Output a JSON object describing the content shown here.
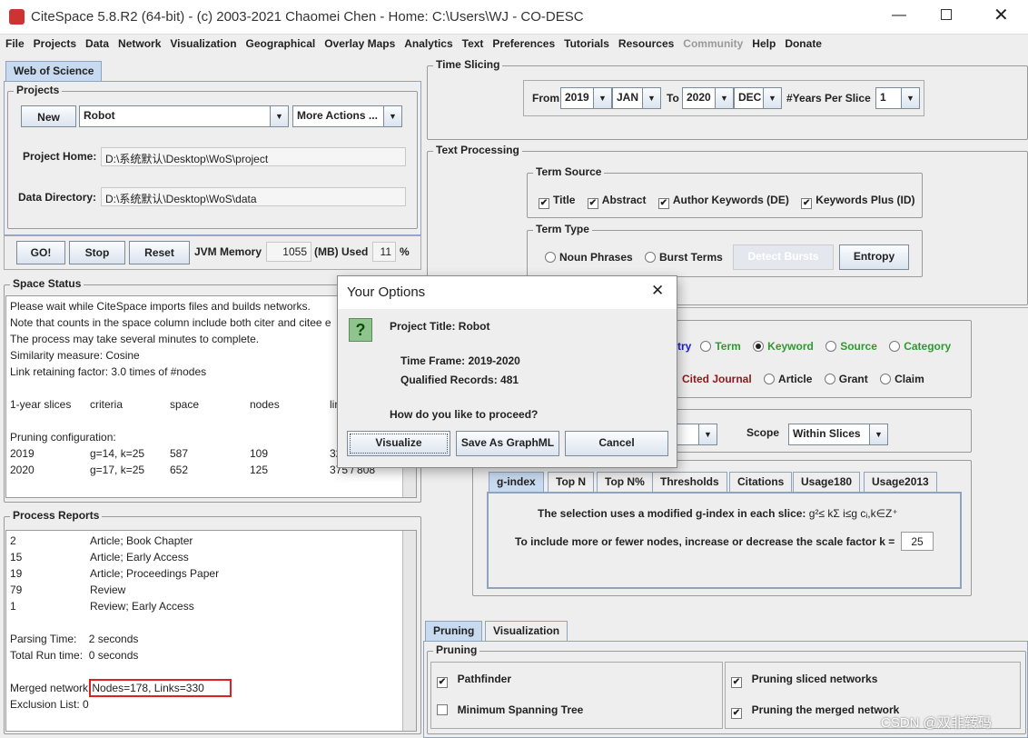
{
  "window": {
    "title": "CiteSpace 5.8.R2 (64-bit) - (c) 2003-2021 Chaomei Chen - Home: C:\\Users\\WJ - CO-DESC"
  },
  "menu": [
    "File",
    "Projects",
    "Data",
    "Network",
    "Visualization",
    "Geographical",
    "Overlay Maps",
    "Analytics",
    "Text",
    "Preferences",
    "Tutorials",
    "Resources",
    "Community",
    "Help",
    "Donate"
  ],
  "left": {
    "tab": "Web of Science",
    "projects": {
      "legend": "Projects",
      "new": "New",
      "project": "Robot",
      "more": "More Actions ...",
      "home_label": "Project Home:",
      "home": "D:\\系统默认\\Desktop\\WoS\\project",
      "data_label": "Data Directory:",
      "data": "D:\\系统默认\\Desktop\\WoS\\data"
    },
    "controls": {
      "go": "GO!",
      "stop": "Stop",
      "reset": "Reset",
      "jvm_label": "JVM Memory",
      "jvm": "1055",
      "mb_label": "(MB) Used",
      "used": "11",
      "pct": "%"
    },
    "space_status": {
      "legend": "Space Status",
      "lines": [
        "Please wait while CiteSpace imports files and builds networks.",
        "Note that counts in the space column include both citer and citee e",
        "The process may take several minutes to complete.",
        "Similarity measure: Cosine",
        "Link retaining factor: 3.0 times of #nodes"
      ],
      "headers": [
        "1-year slices",
        "criteria",
        "space",
        "nodes",
        "lin"
      ],
      "pruning": "Pruning configuration:",
      "rows": [
        [
          "2019",
          "g=14, k=25",
          "587",
          "109",
          "32"
        ],
        [
          "2020",
          "g=17, k=25",
          "652",
          "125",
          "375 / 808"
        ]
      ]
    },
    "process_reports": {
      "legend": "Process Reports",
      "rows": [
        [
          "2",
          "Article; Book Chapter"
        ],
        [
          "15",
          "Article; Early Access"
        ],
        [
          "19",
          "Article; Proceedings Paper"
        ],
        [
          "79",
          "Review"
        ],
        [
          "1",
          "Review; Early Access"
        ]
      ],
      "parsing": "Parsing Time:    2 seconds",
      "total": "Total Run time:  0 seconds",
      "merged_label": "Merged network:",
      "merged": "Nodes=178, Links=330",
      "exclusion": "Exclusion List: 0"
    }
  },
  "right": {
    "time_slicing": {
      "legend": "Time Slicing",
      "from": "From",
      "from_year": "2019",
      "from_month": "JAN",
      "to": "To",
      "to_year": "2020",
      "to_month": "DEC",
      "per_slice_label": "#Years Per Slice",
      "per_slice": "1"
    },
    "text_processing": {
      "legend": "Text Processing",
      "term_source": "Term Source",
      "sources": [
        "Title",
        "Abstract",
        "Author Keywords (DE)",
        "Keywords Plus (ID)"
      ],
      "term_type": "Term Type",
      "noun": "Noun Phrases",
      "burst": "Burst Terms",
      "detect": "Detect Bursts",
      "entropy": "Entropy"
    },
    "node_types": {
      "row1": [
        {
          "label": "try",
          "color": "#1a1adb"
        },
        {
          "label": "Term",
          "color": "#2e9b2e"
        },
        {
          "label": "Keyword",
          "color": "#2e9b2e",
          "selected": true
        },
        {
          "label": "Source",
          "color": "#2e9b2e"
        },
        {
          "label": "Category",
          "color": "#2e9b2e"
        }
      ],
      "row2": [
        {
          "label": "Cited Journal",
          "color": "#8b1a1a"
        },
        {
          "label": "Article",
          "color": "#222"
        },
        {
          "label": "Grant",
          "color": "#222"
        },
        {
          "label": "Claim",
          "color": "#222"
        }
      ]
    },
    "scope_label": "Scope",
    "scope": "Within Slices",
    "selection_tabs": [
      "g-index",
      "Top N",
      "Top N%",
      "Thresholds",
      "Citations",
      "Usage180",
      "Usage2013"
    ],
    "gindex_text": "The selection uses a modified g-index in each slice:",
    "formula": "g²≤ kΣ i≤g cᵢ,k∈Z⁺",
    "scale_label": "To include more or fewer nodes, increase or decrease the scale factor k =",
    "k": "25",
    "bottom_tabs": [
      "Pruning",
      "Visualization"
    ],
    "pruning": {
      "legend": "Pruning",
      "pathfinder": "Pathfinder",
      "mst": "Minimum Spanning Tree",
      "sliced": "Pruning sliced networks",
      "merged": "Pruning the merged network"
    }
  },
  "dialog": {
    "title": "Your Options",
    "project": "Project Title: Robot",
    "frame": "Time Frame: 2019-2020",
    "records": "Qualified Records: 481",
    "question": "How do you like to proceed?",
    "visualize": "Visualize",
    "graphml": "Save As GraphML",
    "cancel": "Cancel"
  },
  "watermark": "CSDN @双非转码"
}
